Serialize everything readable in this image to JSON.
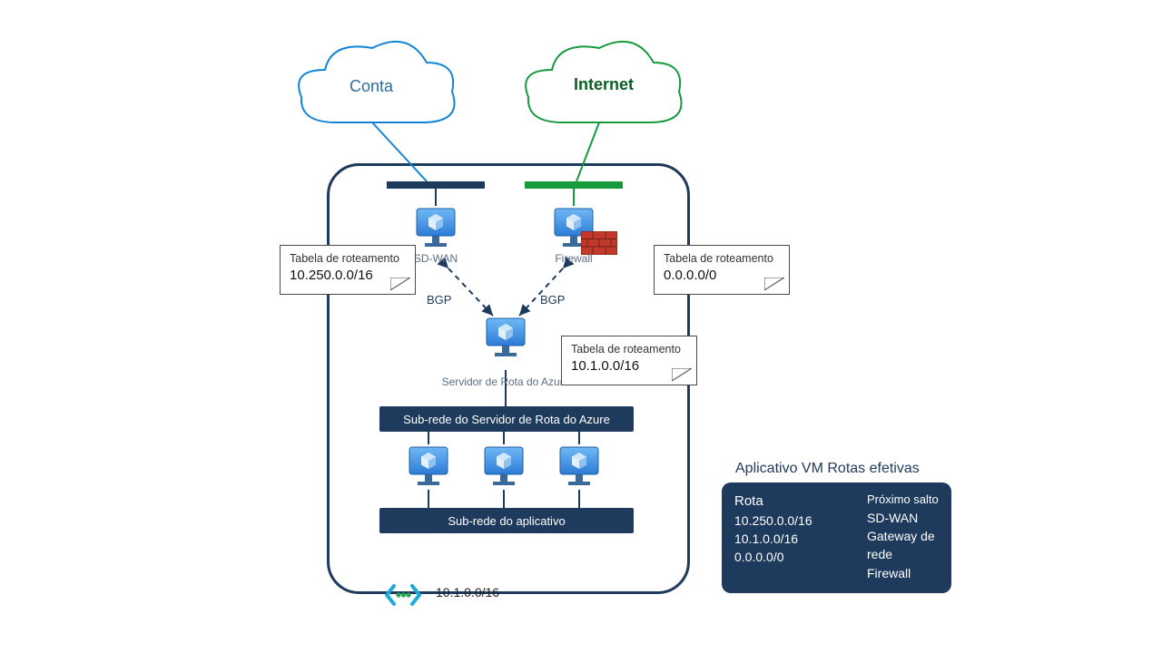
{
  "clouds": {
    "left_label": "Conta",
    "right_label": "Internet"
  },
  "nva": {
    "sdwan_label": "SD-WAN",
    "firewall_label": "Firewall",
    "route_server_label": "Servidor de Rota do Azure"
  },
  "bgp_label": "BGP",
  "subnets": {
    "route_server_subnet": "Sub-rede do Servidor de Rota do Azure",
    "app_subnet": "Sub-rede do aplicativo"
  },
  "route_tables": {
    "header": "Tabela de roteamento",
    "left_value": "10.250.0.0/16",
    "right_value": "0.0.0.0/0",
    "center_value": "10.1.0.0/16"
  },
  "vnet_cidr": "10.1.0.0/16",
  "effective_routes": {
    "title": "Aplicativo VM Rotas efetivas",
    "col_route": "Rota",
    "col_nexthop": "Próximo salto",
    "rows": [
      {
        "route": "10.250.0.0/16",
        "nexthop": "SD-WAN"
      },
      {
        "route": "10.1.0.0/16",
        "nexthop": "Gateway de rede"
      },
      {
        "route": "0.0.0.0/0",
        "nexthop": "Firewall"
      }
    ]
  }
}
